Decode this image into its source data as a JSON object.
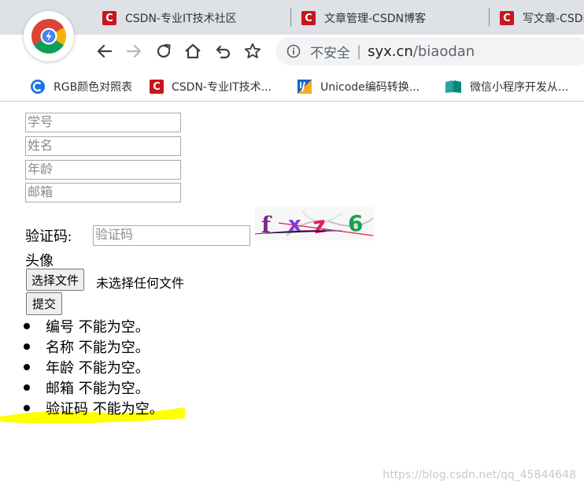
{
  "browser": {
    "tabs": [
      {
        "title": "CSDN-专业IT技术社区",
        "favicon": "C"
      },
      {
        "title": "文章管理-CSDN博客",
        "favicon": "C"
      },
      {
        "title": "写文章-CSDN",
        "favicon": "C"
      }
    ],
    "omnibox": {
      "security_label": "不安全",
      "separator": "|",
      "host": "syx.cn",
      "path": "/biaodan"
    },
    "bookmarks": [
      {
        "label": "RGB颜色对照表",
        "icon": "c-blue-icon"
      },
      {
        "label": "CSDN-专业IT技术...",
        "icon": "csdn-favicon"
      },
      {
        "label": "Unicode编码转换...",
        "icon": "unicode-icon"
      },
      {
        "label": "微信小程序开发从...",
        "icon": "book-icon"
      }
    ],
    "colors": {
      "chrome_bg": "#dee1e6",
      "csdn_red": "#c8161e"
    }
  },
  "form": {
    "fields": [
      {
        "placeholder": "学号"
      },
      {
        "placeholder": "姓名"
      },
      {
        "placeholder": "年龄"
      },
      {
        "placeholder": "邮箱"
      }
    ],
    "captcha": {
      "label": "验证码:",
      "placeholder": "验证码",
      "chars": [
        "f",
        "x",
        "z",
        "6"
      ]
    },
    "avatar_label": "头像",
    "file_button": "选择文件",
    "file_status": "未选择任何文件",
    "submit": "提交"
  },
  "errors": [
    "编号 不能为空。",
    "名称 不能为空。",
    "年龄 不能为空。",
    "邮箱 不能为空。",
    "验证码 不能为空。"
  ],
  "highlight_color": "#ffff00",
  "watermark": "https://blog.csdn.net/qq_45844648"
}
